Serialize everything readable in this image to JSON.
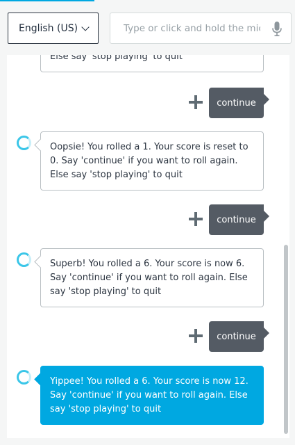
{
  "header": {
    "language_label": "English (US)",
    "input_placeholder": "Type or click and hold the mic"
  },
  "conversation": {
    "partial_top": "Else say 'stop playing' to quit",
    "user_1": "continue",
    "alexa_1": "Oopsie! You rolled a 1. Your score is reset to 0. Say 'continue' if you want to roll again. Else say 'stop playing' to quit",
    "user_2": "continue",
    "alexa_2": "Superb! You rolled a 6. Your score is now 6. Say 'continue' if you want to roll again. Else say 'stop playing' to quit",
    "user_3": "continue",
    "alexa_3": "Yippee! You rolled a 6. Your score is now 12. Say 'continue' if you want to roll again. Else say 'stop playing' to quit"
  },
  "colors": {
    "accent": "#00a8e1",
    "user_bubble": "#545b64",
    "border": "#b9bfc3"
  },
  "icons": [
    "chevron-down-icon",
    "microphone-icon",
    "alexa-ring-icon",
    "plus-icon"
  ]
}
